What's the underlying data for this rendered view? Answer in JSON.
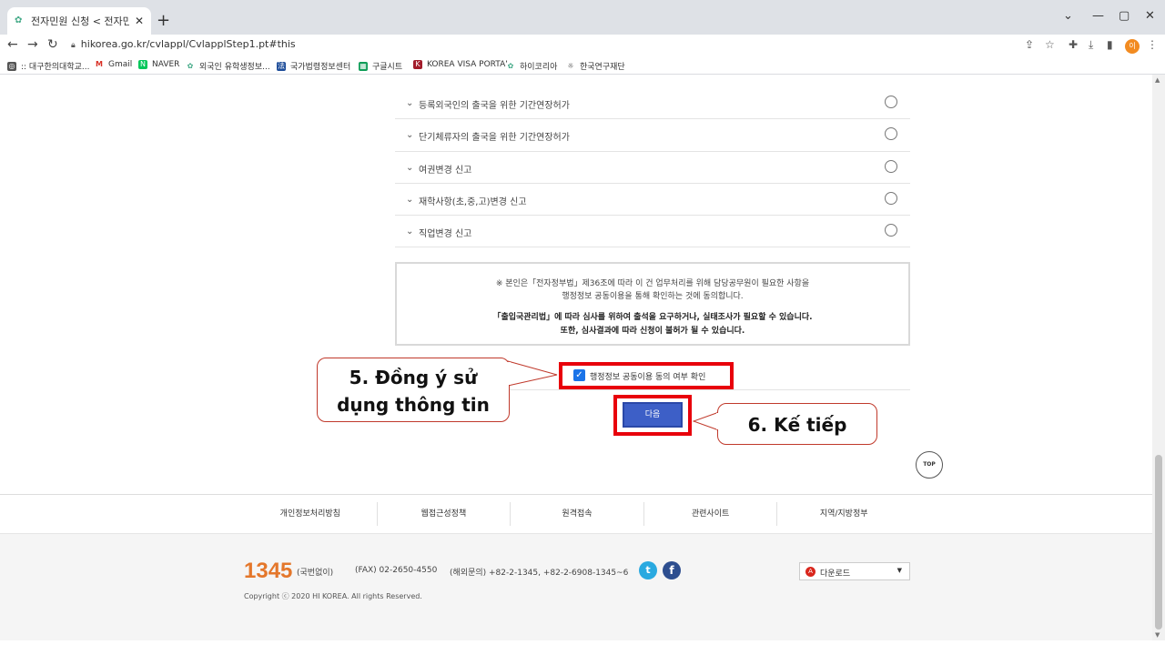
{
  "browser": {
    "tab_title": "전자민원 신청 < 전자민원 < 하",
    "url": "hikorea.go.kr/cvlappl/CvlapplStep1.pt#this",
    "bookmarks": [
      ":: 대구한의대학교...",
      "Gmail",
      "NAVER",
      "외국인 유학생정보...",
      "국가법령정보센터",
      "구글시트",
      "KOREA VISA PORTAL",
      "하이코리아",
      "한국연구재단"
    ],
    "profile_initial": "이"
  },
  "list": {
    "items": [
      {
        "label": "등록외국인의 출국을 위한 기간연장허가"
      },
      {
        "label": "단기체류자의 출국을 위한 기간연장허가"
      },
      {
        "label": "여권변경 신고"
      },
      {
        "label": "재학사항(초,중,고)변경 신고"
      },
      {
        "label": "직업변경 신고"
      }
    ]
  },
  "notice": {
    "line1": "※ 본인은「전자정부법」제36조에 따라 이 건 업무처리를 위해 담당공무원이 필요한 사항을",
    "line2": "행정정보 공동이용을 통해 확인하는 것에 동의합니다.",
    "line3": "「출입국관리법」에 따라 심사를 위하여 출석을 요구하거나, 실태조사가 필요할 수 있습니다.",
    "line4": "또한, 심사결과에 따라 신청이 불허가 될 수 있습니다."
  },
  "agreement": {
    "label": "행정정보 공동이용 동의 여부 확인",
    "checked": true
  },
  "next_button": {
    "label": "다음"
  },
  "top_button": {
    "label": "TOP"
  },
  "callouts": {
    "step5_line1": "5. Đồng ý sử",
    "step5_line2": "dụng thông tin",
    "step6": "6. Kế tiếp"
  },
  "footer": {
    "menu": [
      "개인정보처리방침",
      "웹접근성정책",
      "원격접속",
      "관련사이트",
      "지역/지방정부"
    ],
    "phone": "1345",
    "phone_note": "(국번없이)",
    "fax": "(FAX) 02-2650-4550",
    "overseas": "(해외문의) +82-2-1345, +82-2-6908-1345~6",
    "copyright": "Copyright ⓒ 2020 HI KOREA. All rights Reserved.",
    "download_label": "다운로드"
  },
  "colors": {
    "accent_red": "#e8000b",
    "button_blue": "#3d5fc7",
    "phone_orange": "#e4772b",
    "checkbox_blue": "#1a73e8"
  }
}
